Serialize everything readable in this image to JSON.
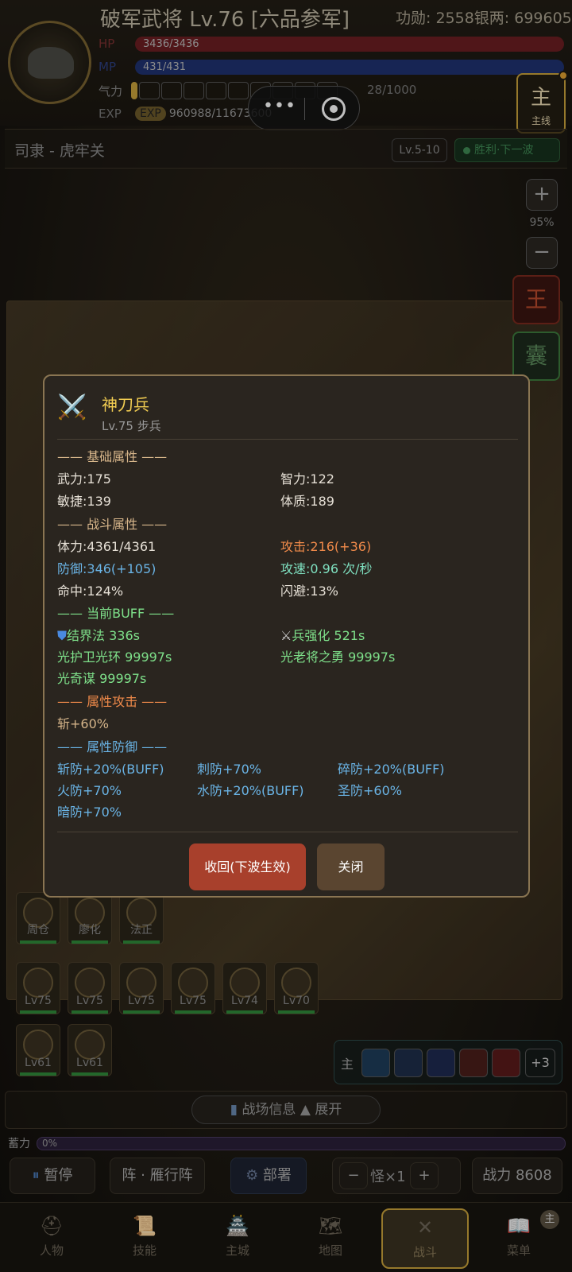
{
  "header": {
    "name": "破军武将 Lv.76 [六品参军]",
    "merit": "功勋: 2558银两: 699605",
    "hp_label": "HP",
    "hp_value": "3436/3436",
    "mp_label": "MP",
    "mp_value": "431/431",
    "qi_label": "气力",
    "qi_value": "28/1000",
    "exp_label": "EXP",
    "exp_pill": "EXP",
    "exp_value": "960988/11673600"
  },
  "quest_button": {
    "big": "主",
    "small": "主线"
  },
  "location": {
    "title": "司隶 - 虎牢关",
    "level": "Lv.5-10",
    "status": "胜利·下一波"
  },
  "zoom": {
    "plus": "+",
    "value": "95%",
    "minus": "−"
  },
  "side_buttons": {
    "king": "王",
    "bag": "囊"
  },
  "modal": {
    "title": "神刀兵",
    "subtitle": "Lv.75 步兵",
    "sec_base": "—— 基础属性 ——",
    "str": "武力:175",
    "int": "智力:122",
    "agi": "敏捷:139",
    "con": "体质:189",
    "sec_battle": "—— 战斗属性 ——",
    "hp": "体力:4361/4361",
    "atk": "攻击:216(+36)",
    "def": "防御:346(+105)",
    "aspd": "攻速:0.96 次/秒",
    "hit": "命中:124%",
    "dodge": "闪避:13%",
    "sec_buff": "—— 当前BUFF ——",
    "buff1": "结界法 336s",
    "buff2": "兵强化 521s",
    "buff3": "光护卫光环 99997s",
    "buff4": "光老将之勇 99997s",
    "buff5": "光奇谋 99997s",
    "sec_elem_atk": "—— 属性攻击 ——",
    "elem_atk1": "斩+60%",
    "sec_elem_def": "—— 属性防御 ——",
    "def1": "斩防+20%(BUFF)",
    "def2": "刺防+70%",
    "def3": "碎防+20%(BUFF)",
    "def4": "火防+70%",
    "def5": "水防+20%(BUFF)",
    "def6": "圣防+60%",
    "def7": "暗防+70%",
    "btn_recall": "收回(下波生效)",
    "btn_close": "关闭"
  },
  "units_row1": [
    "周仓",
    "廖化",
    "法正"
  ],
  "units_row2": [
    "Lv75",
    "Lv75",
    "Lv75",
    "Lv75",
    "Lv74",
    "Lv70"
  ],
  "units_row3": [
    "Lv61",
    "Lv61"
  ],
  "skills": {
    "label": "主",
    "more": "+3"
  },
  "info_bar": {
    "label": "战场信息",
    "expand": "▲ 展开"
  },
  "energy": {
    "label": "蓄力",
    "value": "0%"
  },
  "controls": {
    "pause": "暂停",
    "formation": "阵 · 雁行阵",
    "deploy": "部署",
    "minus": "−",
    "monster": "怪×1",
    "plus": "+",
    "power": "战力 8608"
  },
  "nav": {
    "items": [
      "人物",
      "技能",
      "主城",
      "地图",
      "战斗",
      "菜单"
    ],
    "badge": "主"
  }
}
